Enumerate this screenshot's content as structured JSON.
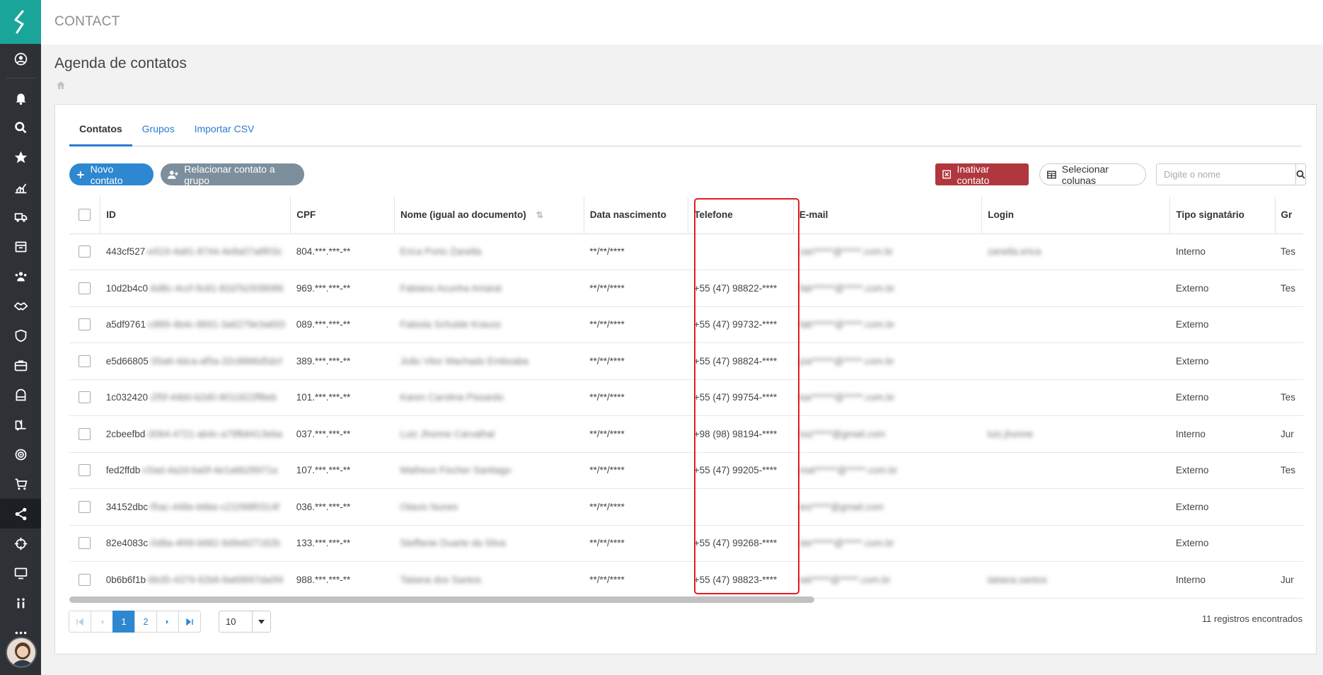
{
  "app": {
    "title": "CONTACT"
  },
  "page": {
    "title": "Agenda de contatos"
  },
  "tabs": [
    {
      "label": "Contatos",
      "active": true
    },
    {
      "label": "Grupos",
      "active": false
    },
    {
      "label": "Importar CSV",
      "active": false
    }
  ],
  "toolbar": {
    "new_contact": "Novo contato",
    "link_group": "Relacionar contato a grupo",
    "inactivate": "Inativar contato",
    "select_columns": "Selecionar colunas",
    "search_placeholder": "Digite o nome"
  },
  "table": {
    "headers": [
      "ID",
      "CPF",
      "Nome (igual ao documento)",
      "Data nascimento",
      "Telefone",
      "E-mail",
      "Login",
      "Tipo signatário",
      "Gr"
    ],
    "rows": [
      {
        "id": "443cf527",
        "id_hidden": "-e919-4a81-8744-4e8a07a8f03c",
        "cpf": "804.***.***-**",
        "nome": "Erica Porto Zanella",
        "nasc": "**/**/****",
        "tel": "",
        "email": "zan*****@*****.com.br",
        "login": "zanella.erica",
        "tipo": "Interno",
        "grupo": "Tes"
      },
      {
        "id": "10d2b4c0",
        "id_hidden": "-6d8c-4ccf-9c81-82d7b2938086",
        "cpf": "969.***.***-**",
        "nome": "Fabiano Acunha Amaral",
        "nasc": "**/**/****",
        "tel": "+55 (47) 98822-****",
        "email": "fab******@*****.com.br",
        "login": "",
        "tipo": "Externo",
        "grupo": "Tes"
      },
      {
        "id": "a5df9761",
        "id_hidden": "-c889-4b4c-8691-3a6279e3a693",
        "cpf": "089.***.***-**",
        "nome": "Fabiola Schulde Krauss",
        "nasc": "**/**/****",
        "tel": "+55 (47) 99732-****",
        "email": "fab******@*****.com.br",
        "login": "",
        "tipo": "Externo",
        "grupo": ""
      },
      {
        "id": "e5d66805",
        "id_hidden": "-55a6-4dca-af5a-32c8886d5dcf",
        "cpf": "389.***.***-**",
        "nome": "João Vitor Machado Emboaba",
        "nasc": "**/**/****",
        "tel": "+55 (47) 98824-****",
        "email": "joa******@*****.com.br",
        "login": "",
        "tipo": "Externo",
        "grupo": ""
      },
      {
        "id": "1c032420",
        "id_hidden": "-2f5f-44b0-b2d0-9011622ff8eb",
        "cpf": "101.***.***-**",
        "nome": "Karen Carolina Pissardo",
        "nasc": "**/**/****",
        "tel": "+55 (47) 99754-****",
        "email": "kar******@*****.com.br",
        "login": "",
        "tipo": "Externo",
        "grupo": "Tes"
      },
      {
        "id": "2cbeefbd",
        "id_hidden": "-3064-4721-ab4c-a79fb6413eba",
        "cpf": "037.***.***-**",
        "nome": "Luiz Jhonne Carvalhal",
        "nasc": "**/**/****",
        "tel": "+98 (98) 98194-****",
        "email": "luiz*****@gmail.com",
        "login": "luiz.jhonne",
        "tipo": "Interno",
        "grupo": "Jur"
      },
      {
        "id": "fed2ffdb",
        "id_hidden": "-c5ad-4a2d-ba0f-4e1a6b28971a",
        "cpf": "107.***.***-**",
        "nome": "Matheus Fischer Santiago",
        "nasc": "**/**/****",
        "tel": "+55 (47) 99205-****",
        "email": "mat******@*****.com.br",
        "login": "",
        "tipo": "Externo",
        "grupo": "Tes"
      },
      {
        "id": "34152dbc",
        "id_hidden": "-f5ac-448e-b6be-c21098f0314f",
        "cpf": "036.***.***-**",
        "nome": "Otavio Nunes",
        "nasc": "**/**/****",
        "tel": "",
        "email": "tes*****@gmail.com",
        "login": "",
        "tipo": "Externo",
        "grupo": ""
      },
      {
        "id": "82e4083c",
        "id_hidden": "-0d8a-4f49-b682-9d9e627162b",
        "cpf": "133.***.***-**",
        "nome": "Steffanie Duarte da Silva",
        "nasc": "**/**/****",
        "tel": "+55 (47) 99268-****",
        "email": "ste******@*****.com.br",
        "login": "",
        "tipo": "Externo",
        "grupo": ""
      },
      {
        "id": "0b6b6f1b",
        "id_hidden": "-6b35-4379-92b8-8a69697da0f4",
        "cpf": "988.***.***-**",
        "nome": "Tatiana dos Santos",
        "nasc": "**/**/****",
        "tel": "+55 (47) 98823-****",
        "email": "tati*****@*****.com.br",
        "login": "tatiana.santos",
        "tipo": "Interno",
        "grupo": "Jur"
      }
    ]
  },
  "pagination": {
    "pages": [
      "1",
      "2"
    ],
    "current": "1",
    "per_page": "10",
    "records": "11 registros encontrados"
  },
  "colors": {
    "primary": "#2d87d1",
    "danger": "#b0373e",
    "sidebar": "#2e3236",
    "logo": "#1aa59b",
    "highlight": "#e01b24"
  }
}
